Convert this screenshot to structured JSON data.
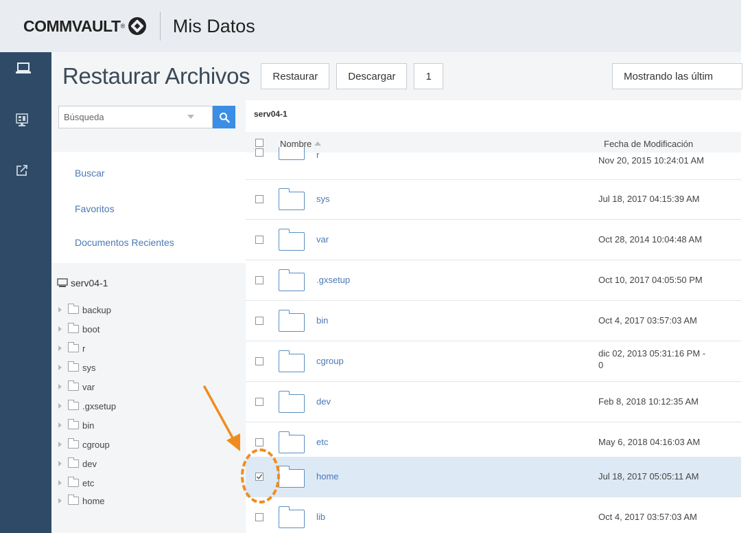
{
  "header": {
    "logo_text": "COMMVAULT",
    "logo_mark": "®",
    "app_title": "Mis Datos"
  },
  "rail": {
    "items": [
      {
        "icon": "laptop-icon"
      },
      {
        "icon": "desktop-monitor-icon"
      },
      {
        "icon": "share-export-icon"
      }
    ]
  },
  "titlebar": {
    "title": "Restaurar Archivos",
    "restore_label": "Restaurar",
    "download_label": "Descargar",
    "count_label": "1",
    "showing_label": "Mostrando las últim"
  },
  "sidebar": {
    "search_placeholder": "Búsqueda",
    "nav": [
      "Buscar",
      "Favoritos",
      "Documentos Recientes"
    ],
    "tree_root": "serv04-1",
    "tree_items": [
      "backup",
      "boot",
      "r",
      "sys",
      "var",
      ".gxsetup",
      "bin",
      "cgroup",
      "dev",
      "etc",
      "home"
    ]
  },
  "content": {
    "breadcrumb": "serv04-1",
    "columns": {
      "name": "Nombre",
      "date": "Fecha de Modificación"
    },
    "partial_row": {
      "name": "r",
      "date": "Nov 20, 2015 10:24:01 AM"
    },
    "rows": [
      {
        "name": "sys",
        "date": "Jul 18, 2017 04:15:39 AM",
        "checked": false
      },
      {
        "name": "var",
        "date": "Oct 28, 2014 10:04:48 AM",
        "checked": false
      },
      {
        "name": ".gxsetup",
        "date": "Oct 10, 2017 04:05:50 PM",
        "checked": false
      },
      {
        "name": "bin",
        "date": "Oct 4, 2017 03:57:03 AM",
        "checked": false
      },
      {
        "name": "cgroup",
        "date": "dic 02, 2013 05:31:16 PM -\n0",
        "checked": false
      },
      {
        "name": "dev",
        "date": "Feb 8, 2018 10:12:35 AM",
        "checked": false
      },
      {
        "name": "etc",
        "date": "May 6, 2018 04:16:03 AM",
        "checked": false
      },
      {
        "name": "home",
        "date": "Jul 18, 2017 05:05:11 AM",
        "checked": true
      },
      {
        "name": "lib",
        "date": "Oct 4, 2017 03:57:03 AM",
        "checked": false
      }
    ]
  },
  "colors": {
    "rail": "#2e4a66",
    "link": "#4a79b5",
    "search_button": "#3a8ee6",
    "selected_row": "#dde9f5",
    "callout": "#f08c1f"
  }
}
